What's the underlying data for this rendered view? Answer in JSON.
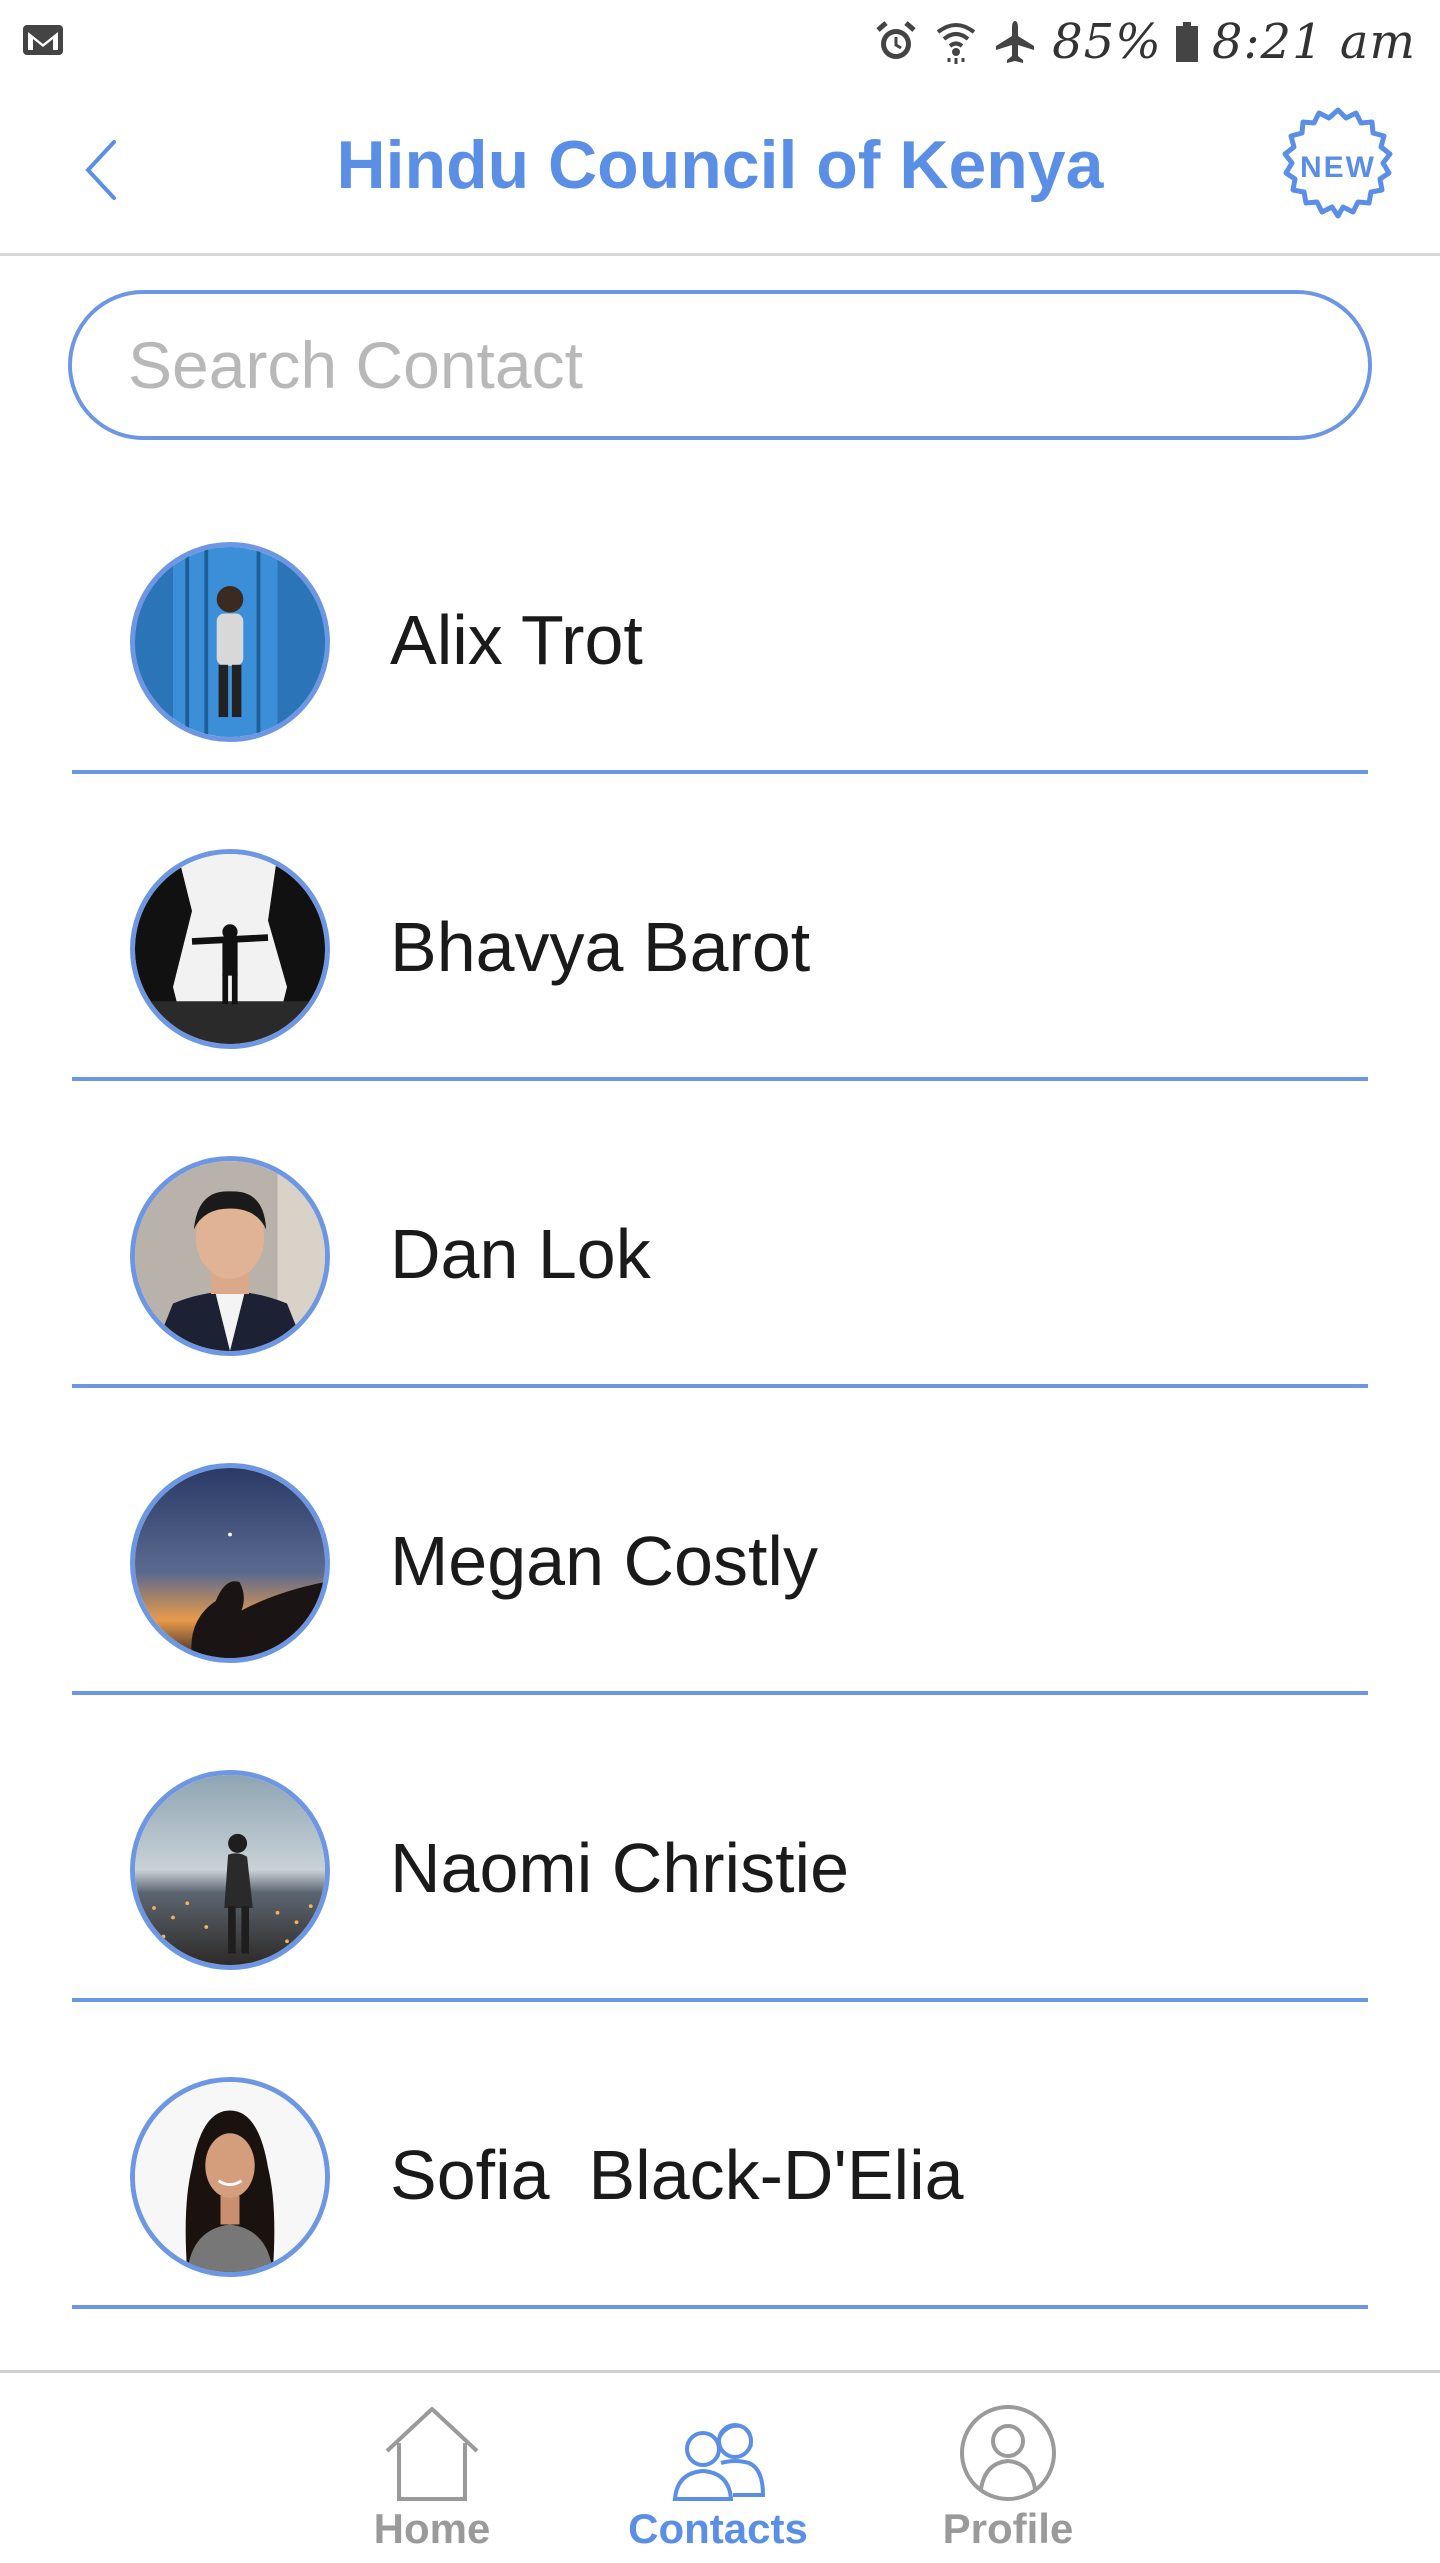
{
  "status_bar": {
    "battery_percent": "85%",
    "time": "8:21 am",
    "icons": [
      "gmail-icon",
      "alarm-icon",
      "wifi-icon",
      "airplane-icon",
      "battery-icon"
    ]
  },
  "header": {
    "title": "Hindu Council of Kenya",
    "back_icon": "chevron-left-icon",
    "new_badge_label": "NEW"
  },
  "search": {
    "placeholder": "Search Contact",
    "value": ""
  },
  "contacts": [
    {
      "name": "Alix Trot"
    },
    {
      "name": "Bhavya Barot"
    },
    {
      "name": "Dan Lok"
    },
    {
      "name": "Megan Costly"
    },
    {
      "name": "Naomi Christie"
    },
    {
      "name": "Sofia  Black-D'Elia"
    }
  ],
  "tab_bar": {
    "tabs": [
      {
        "label": "Home",
        "icon": "home-icon",
        "active": false
      },
      {
        "label": "Contacts",
        "icon": "contacts-icon",
        "active": true
      },
      {
        "label": "Profile",
        "icon": "profile-icon",
        "active": false
      }
    ]
  },
  "colors": {
    "accent": "#5b8fe6",
    "divider": "#6d97e3",
    "inactive_tab": "#9a9a9a"
  }
}
